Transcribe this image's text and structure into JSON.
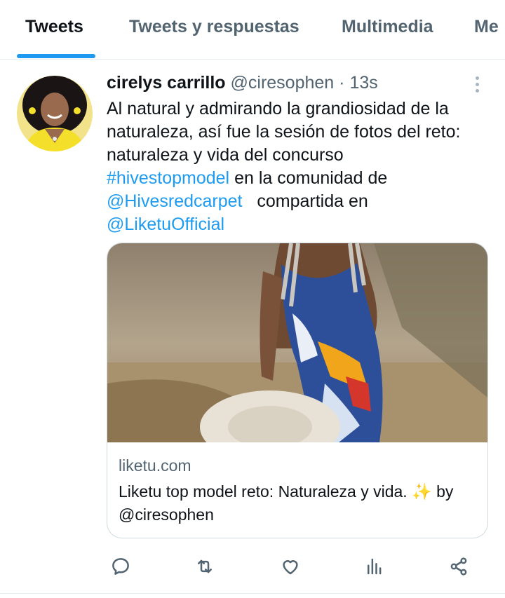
{
  "tabs": [
    "Tweets",
    "Tweets y respuestas",
    "Multimedia",
    "Me"
  ],
  "active_tab": "Tweets",
  "tweet": {
    "author_name": "cirelys carrillo",
    "author_handle": "@ciresophen",
    "separator": "·",
    "time": "13s",
    "text": {
      "line1": "Al natural y admirando la grandiosidad de la",
      "line2": "naturaleza, así fue la sesión de fotos del reto:",
      "line3": "naturaleza y vida del concurso",
      "hashtag": "#hivestopmodel",
      "line4_rest": " en la comunidad de",
      "mention1": "@Hivesredcarpet",
      "line5_rest": "   compartida en",
      "mention2": "@LiketuOfficial"
    },
    "card": {
      "domain": "liketu.com",
      "title": "Liketu top model reto: Naturaleza y vida. ✨ by @ciresophen"
    }
  },
  "icons": {
    "more": "more-vertical-icon",
    "reply": "reply-icon",
    "retweet": "retweet-icon",
    "like": "heart-icon",
    "views": "analytics-icon",
    "share": "share-icon"
  },
  "colors": {
    "accent": "#1d9bf0",
    "text_primary": "#0f1419",
    "text_secondary": "#536471"
  }
}
